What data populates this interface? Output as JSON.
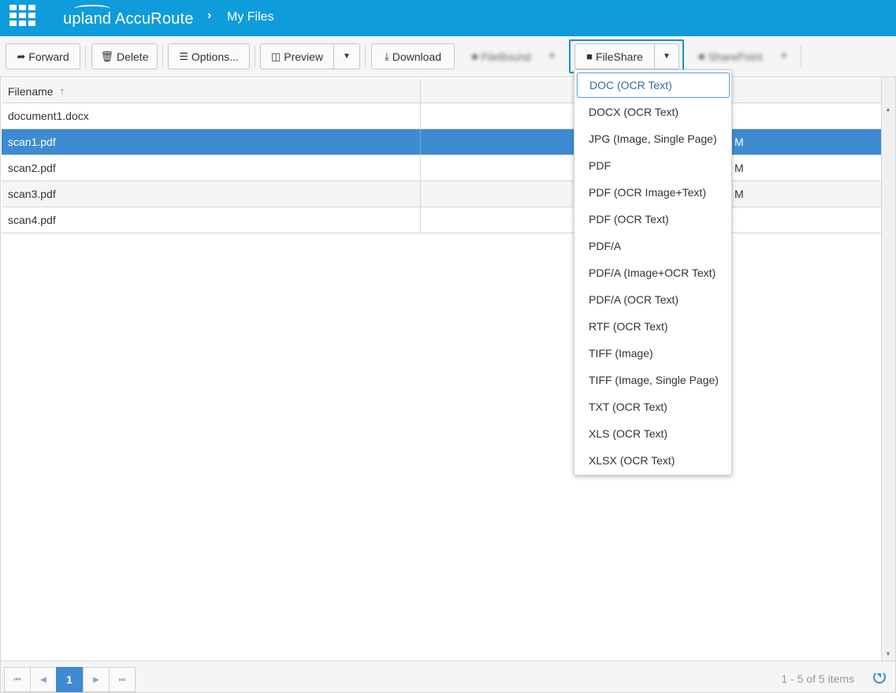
{
  "header": {
    "app_name": "upland AccuRoute",
    "breadcrumb_separator": "›",
    "title": "My Files"
  },
  "toolbar": {
    "forward_label": "Forward",
    "delete_label": "Delete",
    "options_label": "Options...",
    "preview_label": "Preview",
    "download_label": "Download",
    "blurred1_label": "FileBound",
    "fileshare_label": "FileShare",
    "blurred2_label": "SharePoint"
  },
  "table": {
    "columns": [
      "Filename",
      ""
    ],
    "rows": [
      {
        "filename": "document1.docx",
        "extra": ""
      },
      {
        "filename": "scan1.pdf",
        "extra": "M"
      },
      {
        "filename": "scan2.pdf",
        "extra": "M"
      },
      {
        "filename": "scan3.pdf",
        "extra": "M"
      },
      {
        "filename": "scan4.pdf",
        "extra": ""
      }
    ],
    "selected_row": 1
  },
  "dropdown": {
    "items": [
      "DOC (OCR Text)",
      "DOCX (OCR Text)",
      "JPG (Image, Single Page)",
      "PDF",
      "PDF (OCR Image+Text)",
      "PDF (OCR Text)",
      "PDF/A",
      "PDF/A (Image+OCR Text)",
      "PDF/A (OCR Text)",
      "RTF (OCR Text)",
      "TIFF (Image)",
      "TIFF (Image, Single Page)",
      "TXT (OCR Text)",
      "XLS (OCR Text)",
      "XLSX (OCR Text)"
    ]
  },
  "pager": {
    "current_page": "1",
    "info": "1 - 5 of 5 items"
  },
  "colors": {
    "header_bg": "#0e9cdb",
    "selection": "#3e8bd1",
    "focus_ring": "#1e8fc6"
  }
}
